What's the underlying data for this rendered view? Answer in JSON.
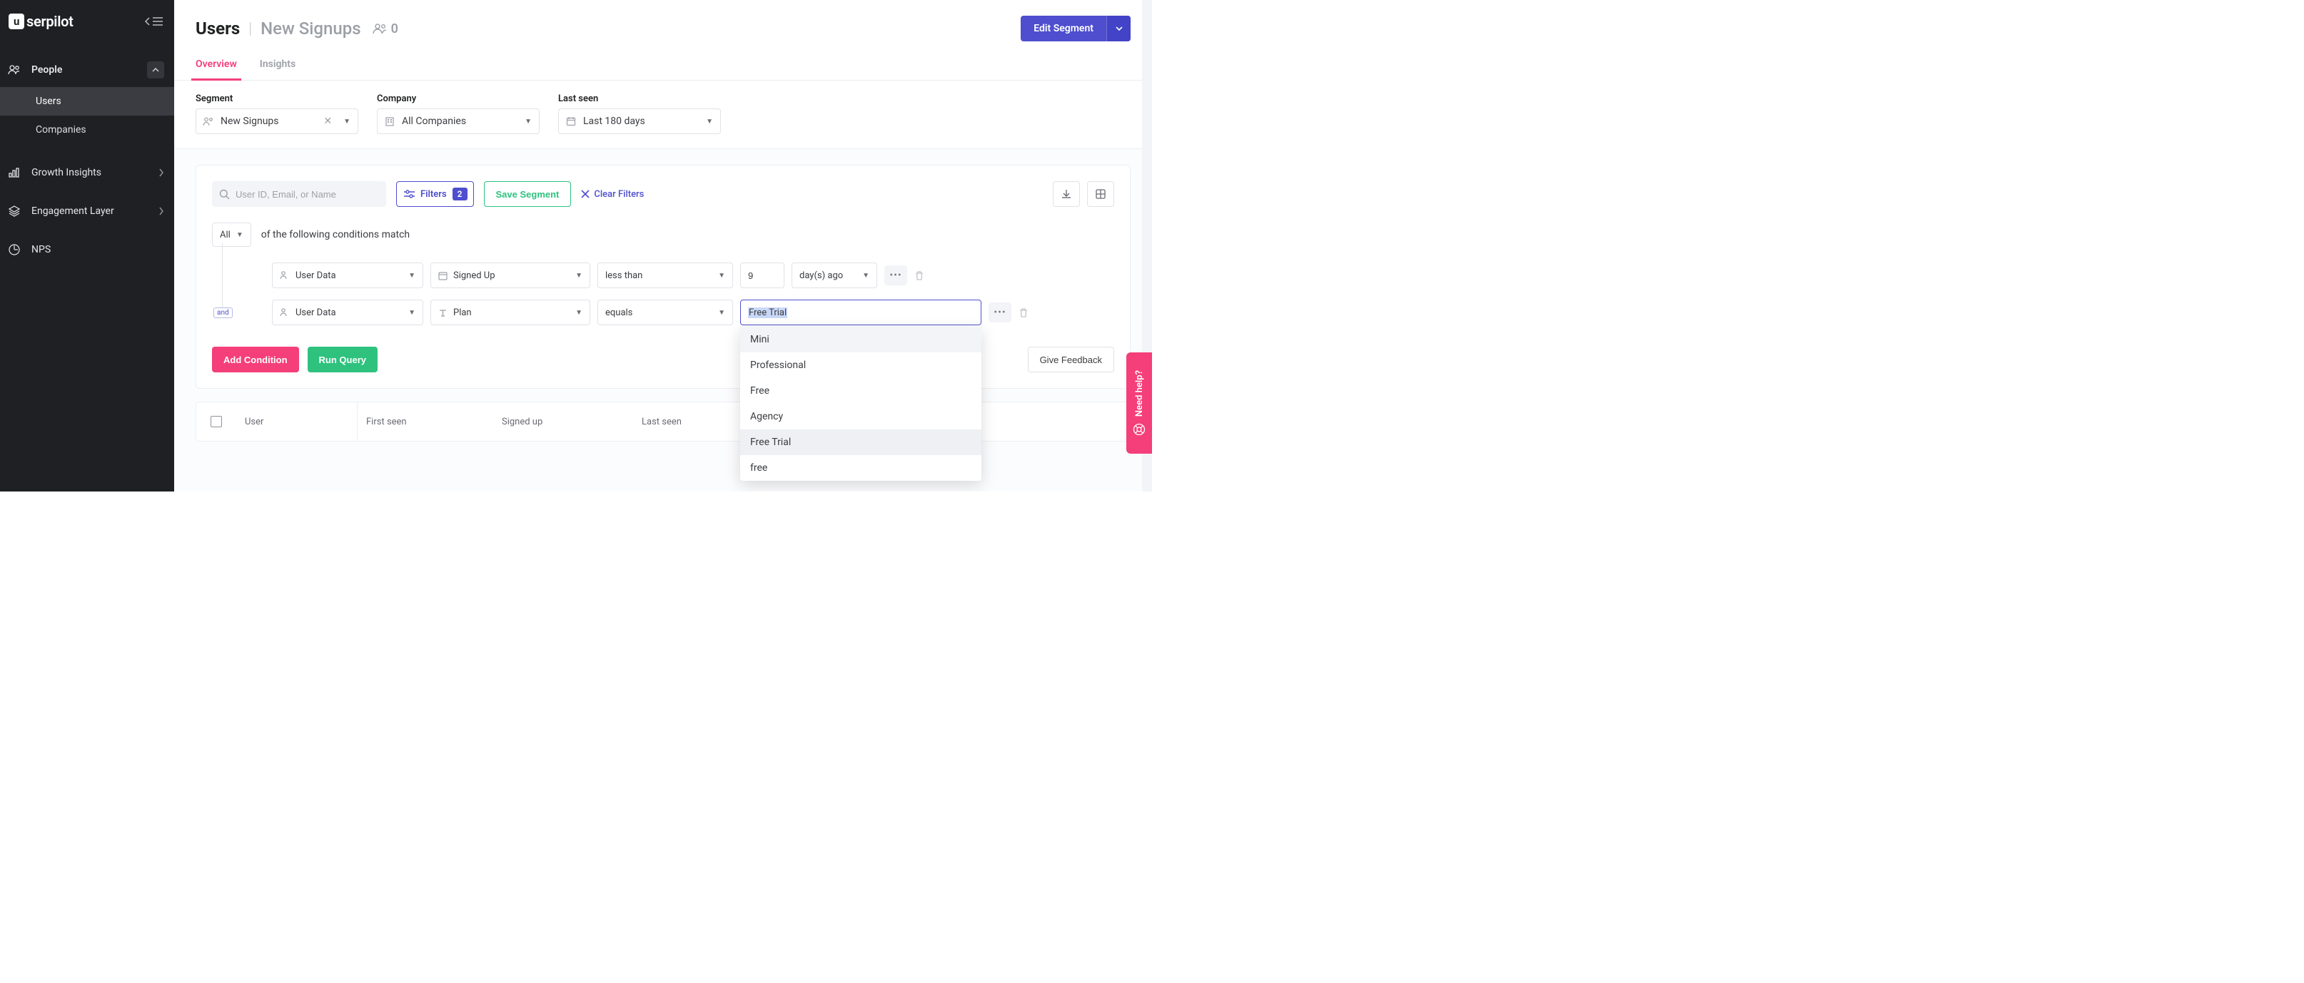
{
  "brand": "serpilot",
  "sidebar": {
    "sections": {
      "people": {
        "label": "People",
        "items": [
          "Users",
          "Companies"
        ]
      },
      "growth": {
        "label": "Growth Insights"
      },
      "engagement": {
        "label": "Engagement Layer"
      },
      "nps": {
        "label": "NPS"
      }
    }
  },
  "header": {
    "title": "Users",
    "subtitle": "New Signups",
    "count": "0",
    "edit_segment": "Edit Segment"
  },
  "tabs": {
    "overview": "Overview",
    "insights": "Insights"
  },
  "filterbar": {
    "segment_label": "Segment",
    "segment_value": "New Signups",
    "company_label": "Company",
    "company_value": "All Companies",
    "lastseen_label": "Last seen",
    "lastseen_value": "Last 180 days"
  },
  "panel": {
    "search_placeholder": "User ID, Email, or Name",
    "filters_label": "Filters",
    "filters_count": "2",
    "save_segment": "Save Segment",
    "clear_filters": "Clear Filters",
    "match_scope": "All",
    "match_text": "of the following conditions match",
    "cond1": {
      "scope": "User Data",
      "attr": "Signed Up",
      "op": "less than",
      "val": "9",
      "unit": "day(s) ago"
    },
    "cond2": {
      "join": "and",
      "scope": "User Data",
      "attr": "Plan",
      "op": "equals",
      "val": "Free Trial"
    },
    "add_condition": "Add Condition",
    "run_query": "Run Query",
    "give_feedback": "Give Feedback"
  },
  "dropdown": {
    "items": [
      "Mini",
      "Professional",
      "Free",
      "Agency",
      "Free Trial",
      "free"
    ]
  },
  "table": {
    "cols": {
      "user": "User",
      "first_seen": "First seen",
      "signed_up": "Signed up",
      "last_seen": "Last seen"
    }
  },
  "need_help": "Need help?"
}
